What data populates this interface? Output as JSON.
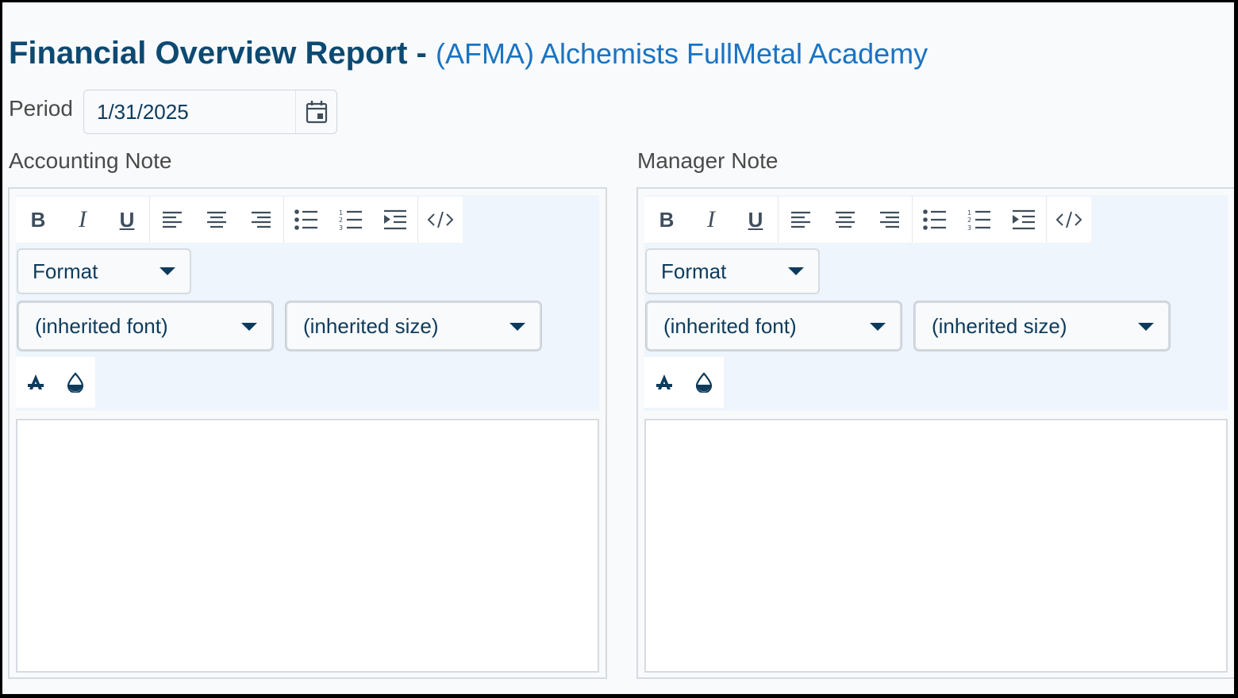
{
  "header": {
    "title": "Financial Overview Report -",
    "organization": "(AFMA) Alchemists FullMetal Academy"
  },
  "period": {
    "label": "Period",
    "value": "1/31/2025",
    "calendar_icon": "calendar-icon"
  },
  "editors": [
    {
      "label": "Accounting Note",
      "format_select": "Format",
      "font_select": "(inherited font)",
      "size_select": "(inherited size)",
      "content": ""
    },
    {
      "label": "Manager Note",
      "format_select": "Format",
      "font_select": "(inherited font)",
      "size_select": "(inherited size)",
      "content": ""
    }
  ],
  "toolbar": {
    "bold": "B",
    "italic": "I",
    "underline": "U",
    "icons": [
      "bold-icon",
      "italic-icon",
      "underline-icon",
      "align-left-icon",
      "align-center-icon",
      "align-right-icon",
      "bullet-list-icon",
      "numbered-list-icon",
      "indent-icon",
      "code-view-icon",
      "font-color-icon",
      "background-color-icon"
    ]
  },
  "colors": {
    "title": "#0d4a72",
    "organization": "#1a73c2",
    "icon": "#3f4e5c",
    "toolbar_bg": "#eef5fc"
  }
}
